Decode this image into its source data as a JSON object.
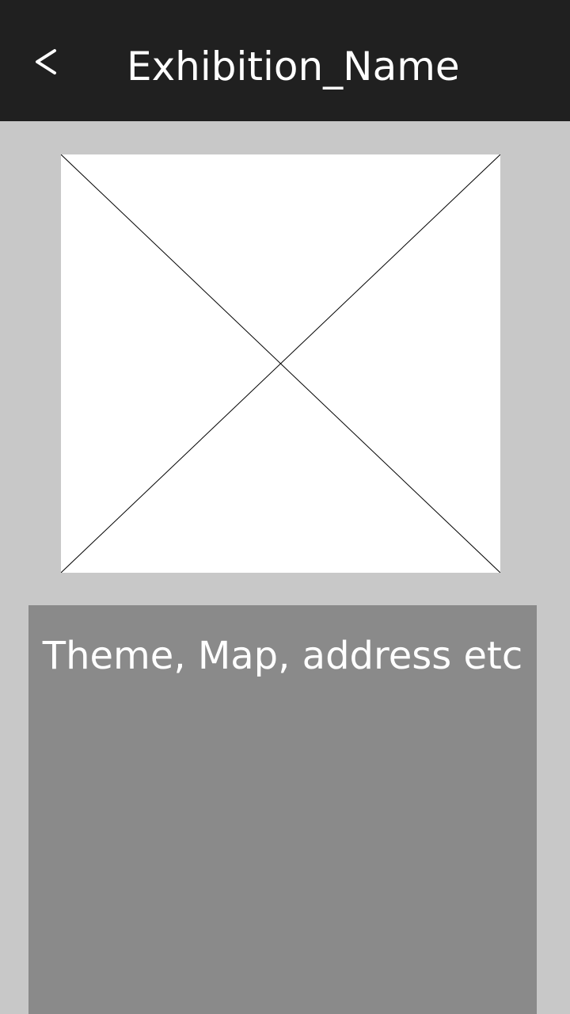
{
  "header": {
    "back_glyph": "<",
    "title": "Exhibition_Name"
  },
  "image": {
    "icon": "image-placeholder-cross"
  },
  "info": {
    "text": "Theme, Map, address etc"
  },
  "colors": {
    "app_bar": "#202020",
    "background": "#c8c8c8",
    "panel": "#8a8a8a",
    "text": "#ffffff"
  }
}
